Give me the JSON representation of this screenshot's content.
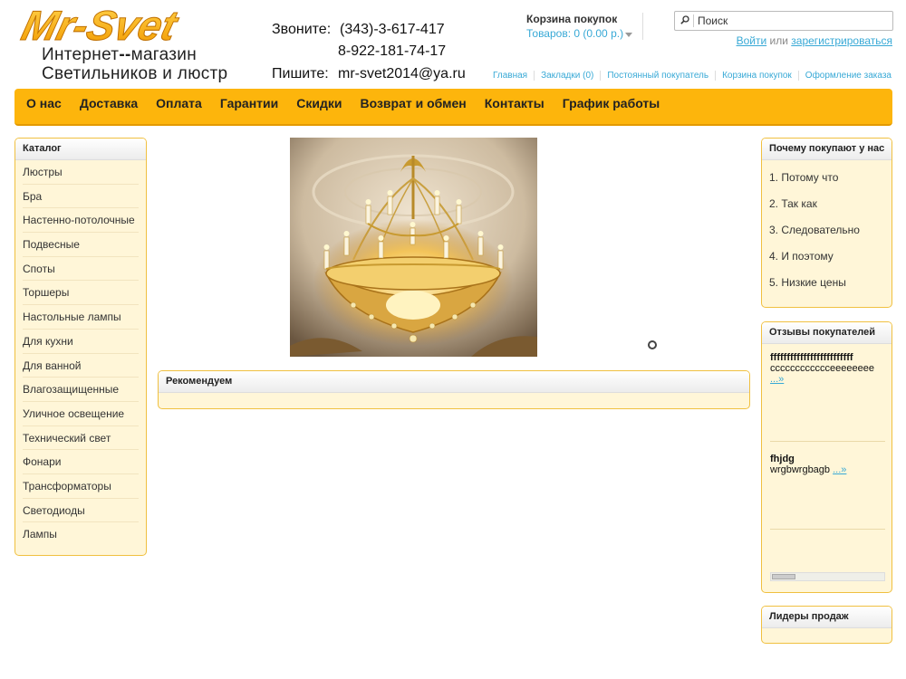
{
  "logo": {
    "text": "Mr-Svet",
    "line1": "Интернет",
    "dash": "--",
    "line1b": "магазин",
    "line2": "Светильников и люстр"
  },
  "contacts": {
    "call_label": "Звоните:",
    "phone1": "(343)-3-617-417",
    "phone2": "8-922-181-74-17",
    "write_label": "Пишите:",
    "email": "mr-svet2014@ya.ru"
  },
  "cart": {
    "title": "Корзина покупок",
    "info": "Товаров: 0 (0.00 р.)"
  },
  "search": {
    "placeholder": "Поиск"
  },
  "auth": {
    "login": "Войти",
    "or": "или",
    "register": "зарегистрироваться"
  },
  "toplinks": [
    "Главная",
    "Закладки (0)",
    "Постоянный покупатель",
    "Корзина покупок",
    "Оформление заказа"
  ],
  "menu": [
    "О нас",
    "Доставка",
    "Оплата",
    "Гарантии",
    "Скидки",
    "Возврат и обмен",
    "Контакты",
    "График работы"
  ],
  "catalog": {
    "title": "Каталог",
    "items": [
      "Люстры",
      "Бра",
      "Настенно-потолочные",
      "Подвесные",
      "Споты",
      "Торшеры",
      "Настольные лампы",
      "Для кухни",
      "Для ванной",
      "Влагозащищенные",
      "Уличное освещение",
      "Технический свет",
      "Фонари",
      "Трансформаторы",
      "Светодиоды",
      "Лампы"
    ]
  },
  "recommend": {
    "title": "Рекомендуем"
  },
  "whybuy": {
    "title": "Почему покупают у нас",
    "items": [
      "1. Потому что",
      "2. Так как",
      "3. Следовательно",
      "4. И поэтому",
      "5. Низкие цены"
    ]
  },
  "reviews": {
    "title": "Отзывы покупателей",
    "items": [
      {
        "name": "fffffffffffffffffffffffff",
        "text": "cccccccccccceeeeeeee",
        "more": "...»"
      },
      {
        "name": "fhjdg",
        "text": "wrgbwrgbagb",
        "more": "...»"
      }
    ]
  },
  "leaders": {
    "title": "Лидеры продаж"
  },
  "colors": {
    "accent": "#fdb50c",
    "link": "#38a9d6",
    "box_bg": "#fff6d8",
    "box_border": "#f0c040"
  }
}
